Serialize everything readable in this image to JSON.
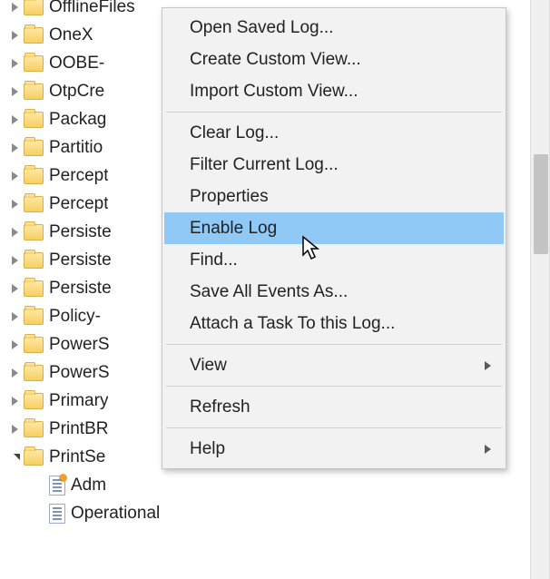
{
  "tree": {
    "items": [
      {
        "label": "OfflineFiles",
        "expand": "collapsed",
        "icon": "folder",
        "partialCut": true
      },
      {
        "label": "OneX",
        "expand": "collapsed",
        "icon": "folder"
      },
      {
        "label": "OOBE-",
        "expand": "collapsed",
        "icon": "folder"
      },
      {
        "label": "OtpCre",
        "expand": "collapsed",
        "icon": "folder"
      },
      {
        "label": "Packag",
        "expand": "collapsed",
        "icon": "folder"
      },
      {
        "label": "Partitio",
        "expand": "collapsed",
        "icon": "folder"
      },
      {
        "label": "Percept",
        "expand": "collapsed",
        "icon": "folder"
      },
      {
        "label": "Percept",
        "expand": "collapsed",
        "icon": "folder"
      },
      {
        "label": "Persiste",
        "expand": "collapsed",
        "icon": "folder"
      },
      {
        "label": "Persiste",
        "expand": "collapsed",
        "icon": "folder"
      },
      {
        "label": "Persiste",
        "expand": "collapsed",
        "icon": "folder"
      },
      {
        "label": "Policy-",
        "expand": "collapsed",
        "icon": "folder"
      },
      {
        "label": "PowerS",
        "expand": "collapsed",
        "icon": "folder"
      },
      {
        "label": "PowerS",
        "expand": "collapsed",
        "icon": "folder"
      },
      {
        "label": "Primary",
        "expand": "collapsed",
        "icon": "folder"
      },
      {
        "label": "PrintBR",
        "expand": "collapsed",
        "icon": "folder"
      },
      {
        "label": "PrintSe",
        "expand": "expanded",
        "icon": "folder"
      }
    ],
    "children": [
      {
        "label": "Adm",
        "icon": "log-admin"
      },
      {
        "label": "Operational",
        "icon": "log",
        "selected": true
      }
    ]
  },
  "contextMenu": {
    "groups": [
      [
        {
          "label": "Open Saved Log..."
        },
        {
          "label": "Create Custom View..."
        },
        {
          "label": "Import Custom View..."
        }
      ],
      [
        {
          "label": "Clear Log..."
        },
        {
          "label": "Filter Current Log..."
        },
        {
          "label": "Properties"
        },
        {
          "label": "Enable Log",
          "highlight": true
        },
        {
          "label": "Find..."
        },
        {
          "label": "Save All Events As..."
        },
        {
          "label": "Attach a Task To this Log..."
        }
      ],
      [
        {
          "label": "View",
          "submenu": true
        }
      ],
      [
        {
          "label": "Refresh"
        }
      ],
      [
        {
          "label": "Help",
          "submenu": true
        }
      ]
    ]
  }
}
